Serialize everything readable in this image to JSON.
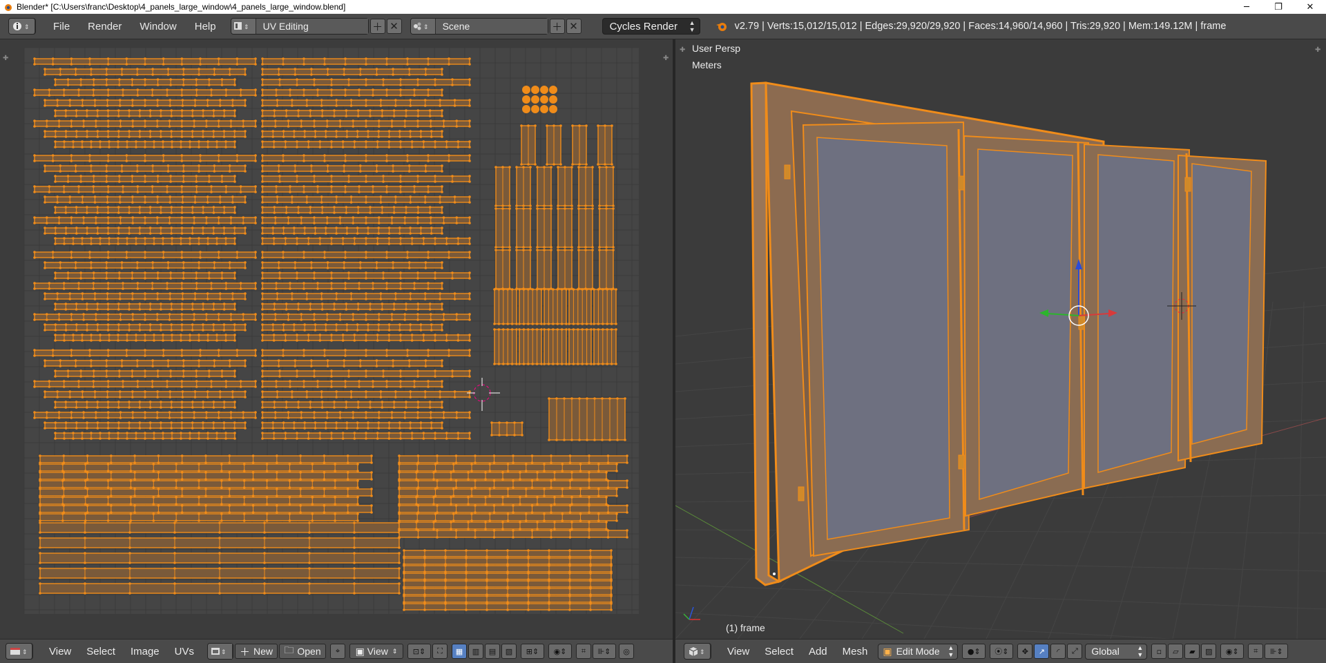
{
  "window": {
    "title": "Blender* [C:\\Users\\franc\\Desktop\\4_panels_large_window\\4_panels_large_window.blend]",
    "controls": [
      "─",
      "❐",
      "✕"
    ]
  },
  "info_header": {
    "menus": [
      "File",
      "Render",
      "Window",
      "Help"
    ],
    "screen_layout": "UV Editing",
    "scene": "Scene",
    "render_engine": "Cycles Render",
    "stats": "v2.79 | Verts:15,012/15,012 | Edges:29,920/29,920 | Faces:14,960/14,960 | Tris:29,920 | Mem:149.12M | frame"
  },
  "uv_editor": {
    "header": {
      "menus": [
        "View",
        "Select",
        "Image",
        "UVs"
      ],
      "new_label": "New",
      "open_label": "Open",
      "view_label": "View"
    }
  },
  "viewport": {
    "perspective_label": "User Persp",
    "units_label": "Meters",
    "object_label": "(1) frame",
    "header": {
      "menus": [
        "View",
        "Select",
        "Add",
        "Mesh"
      ],
      "mode": "Edit Mode",
      "orientation": "Global"
    }
  },
  "colors": {
    "uv_orange": "#f08c1a",
    "uv_fill": "#7a5a3a",
    "background": "#3c3c3c",
    "glass": "#6e7080",
    "frame": "#8a6c52"
  },
  "icons": [
    "blender-info-icon",
    "screen-layout-icon",
    "scene-icon",
    "blender-logo-icon",
    "image-editor-icon",
    "3d-view-icon",
    "sphere-shading-icon",
    "manipulator-icon"
  ]
}
